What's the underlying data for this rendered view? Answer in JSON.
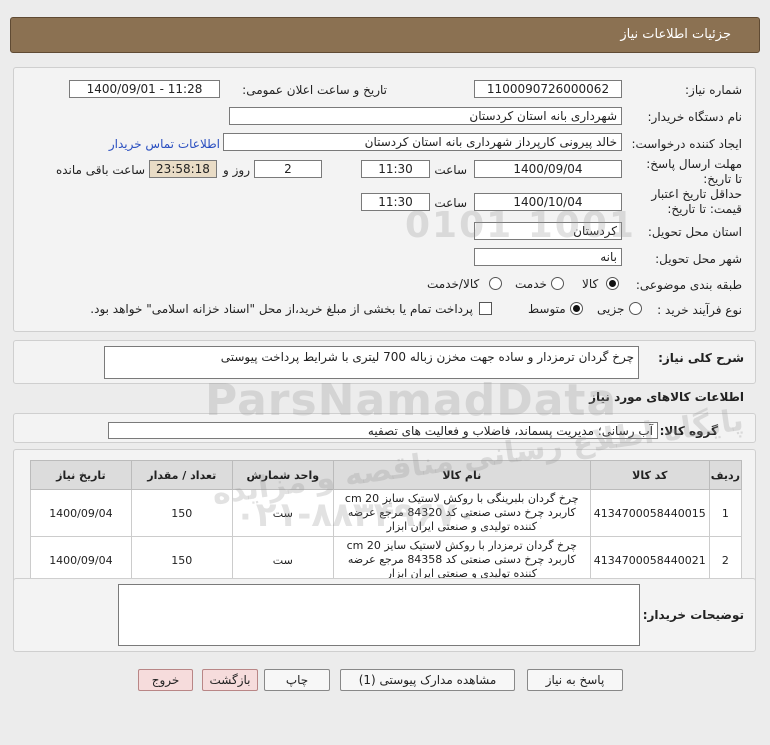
{
  "header": {
    "title": "جزئیات اطلاعات نیاز"
  },
  "form": {
    "need_number_label": "شماره نیاز:",
    "need_number": "1100090726000062",
    "announce_label": "تاریخ و ساعت اعلان عمومی:",
    "announce_value": "1400/09/01 - 11:28",
    "buyer_org_label": "نام دستگاه خریدار:",
    "buyer_org": "شهرداری بانه استان کردستان",
    "requester_label": "ایجاد کننده درخواست:",
    "requester": "خالد پیرونی کارپرداز شهرداری بانه استان کردستان",
    "contact_link": "اطلاعات تماس خریدار",
    "deadline_label": "مهلت ارسال پاسخ: تا تاریخ:",
    "deadline_date": "1400/09/04",
    "time_label": "ساعت",
    "deadline_time": "11:30",
    "days_value": "2",
    "days_label": "روز و",
    "remaining_time": "23:58:18",
    "remaining_label": "ساعت باقی مانده",
    "validity_label": "حداقل تاریخ اعتبار قیمت: تا تاریخ:",
    "validity_date": "1400/10/04",
    "validity_time_label": "ساعت",
    "validity_time": "11:30",
    "province_label": "استان محل تحویل:",
    "province": "کردستان",
    "city_label": "شهر محل تحویل:",
    "city": "بانه",
    "category_label": "طبقه بندی موضوعی:",
    "category_options": [
      "کالا",
      "خدمت",
      "کالا/خدمت"
    ],
    "category_selected": "کالا",
    "process_label": "نوع فرآیند خرید :",
    "process_options": [
      "جزیی",
      "متوسط"
    ],
    "process_selected": "متوسط",
    "payment_note": "پرداخت تمام یا بخشی از مبلغ خرید،از محل \"اسناد خزانه اسلامی\" خواهد بود."
  },
  "description": {
    "label": "شرح کلی نیاز:",
    "text": "چرخ گردان ترمزدار و ساده جهت مخزن زباله 700 لیتری با شرایط پرداخت پیوستی"
  },
  "goods_info": {
    "title": "اطلاعات کالاهای مورد نیاز",
    "group_label": "گروه کالا:",
    "group_value": "آب رسانی؛ مدیریت پسماند، فاضلاب و فعالیت های تصفیه"
  },
  "table": {
    "headers": [
      "ردیف",
      "کد کالا",
      "نام کالا",
      "واحد شمارش",
      "تعداد / مقدار",
      "تاریخ نیاز"
    ],
    "rows": [
      [
        "1",
        "4134700058440015",
        "چرخ گردان بلبرینگی با روکش لاستیک سایز cm 20 کاربرد چرخ دستی صنعتی کد 84320 مرجع عرضه کننده تولیدی و صنعتی ایران ابزار",
        "ست",
        "150",
        "1400/09/04"
      ],
      [
        "2",
        "4134700058440021",
        "چرخ گردان ترمزدار با روکش لاستیک سایز cm 20 کاربرد چرخ دستی صنعتی کد 84358 مرجع عرضه کننده تولیدی و صنعتی ایران ابزار",
        "ست",
        "150",
        "1400/09/04"
      ]
    ]
  },
  "buyer_notes": {
    "label": "توضیحات خریدار:",
    "text": ""
  },
  "buttons": {
    "reply": "پاسخ به نیاز",
    "attachments": "مشاهده مدارک پیوستی (1)",
    "print": "چاپ",
    "back": "بازگشت",
    "exit": "خروج"
  },
  "watermark": {
    "line1": "ParsNamadData",
    "line2": "پایگاه اطلاع رسانی مناقصه و مزایده",
    "line3": "۰۲۱-۸۸۳۴۹۶۷۰",
    "line4": "0101 1001"
  }
}
